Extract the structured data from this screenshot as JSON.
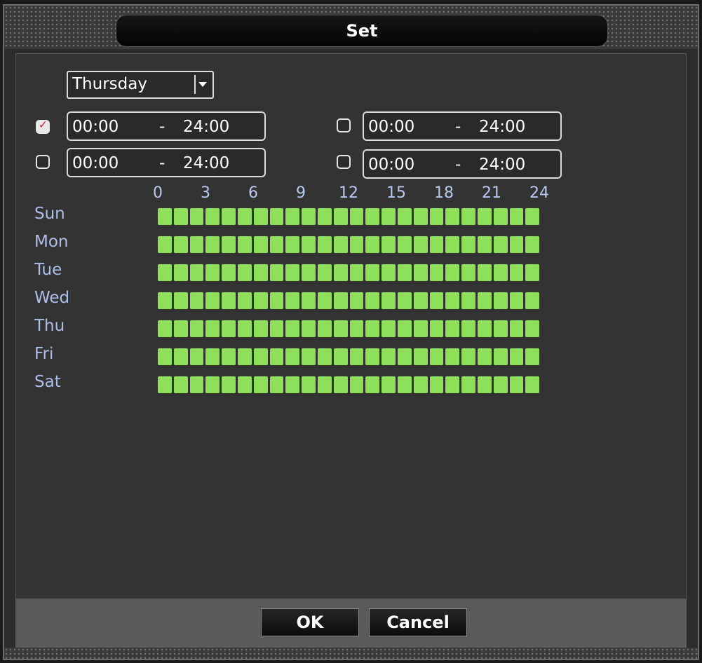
{
  "window": {
    "title": "Set"
  },
  "day_select": {
    "value": "Thursday"
  },
  "periods": [
    {
      "checked": true,
      "start": "00:00",
      "end": "24:00"
    },
    {
      "checked": false,
      "start": "00:00",
      "end": "24:00"
    },
    {
      "checked": false,
      "start": "00:00",
      "end": "24:00"
    },
    {
      "checked": false,
      "start": "00:00",
      "end": "24:00"
    }
  ],
  "period_separator": "-",
  "hour_labels": [
    "0",
    "3",
    "6",
    "9",
    "12",
    "15",
    "18",
    "21",
    "24"
  ],
  "days": [
    "Sun",
    "Mon",
    "Tue",
    "Wed",
    "Thu",
    "Fri",
    "Sat"
  ],
  "slots_per_day": 24,
  "schedule_color": "#8ee05a",
  "buttons": {
    "ok": "OK",
    "cancel": "Cancel"
  }
}
